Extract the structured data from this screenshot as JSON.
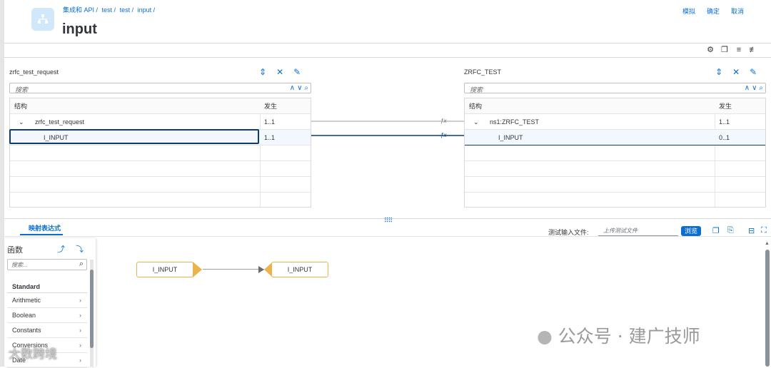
{
  "breadcrumb": [
    "集成和 API /",
    "test /",
    "test /",
    "input /"
  ],
  "page_title": "input",
  "header_buttons": {
    "simulate": "模拟",
    "confirm": "确定",
    "cancel": "取消"
  },
  "source": {
    "title": "zrfc_test_request",
    "search_placeholder": "搜索",
    "col_structure": "结构",
    "col_occurrence": "发生",
    "rows": [
      {
        "name": "zrfc_test_request",
        "occ": "1..1"
      },
      {
        "name": "I_INPUT",
        "occ": "1..1"
      }
    ]
  },
  "target": {
    "title": "ZRFC_TEST",
    "search_placeholder": "搜索",
    "col_structure": "结构",
    "col_occurrence": "发生",
    "rows": [
      {
        "name": "ns1:ZRFC_TEST",
        "occ": "1..1"
      },
      {
        "name": "I_INPUT",
        "occ": "0..1"
      }
    ]
  },
  "mapping_tab": "映射表达式",
  "test_input": {
    "label": "测试输入文件:",
    "placeholder": "上传测试文件",
    "browse": "浏览"
  },
  "functions": {
    "title": "函数",
    "search_placeholder": "搜索...",
    "group": "Standard",
    "items": [
      "Arithmetic",
      "Boolean",
      "Constants",
      "Conversions",
      "Date"
    ]
  },
  "expression": {
    "source_node": "I_INPUT",
    "target_node": "I_INPUT"
  },
  "watermarks": {
    "wechat": "公众号 · 建广技师",
    "corner": "大数跨境"
  },
  "colors": {
    "accent": "#0a6ed1",
    "node_border": "#e9b44c"
  }
}
